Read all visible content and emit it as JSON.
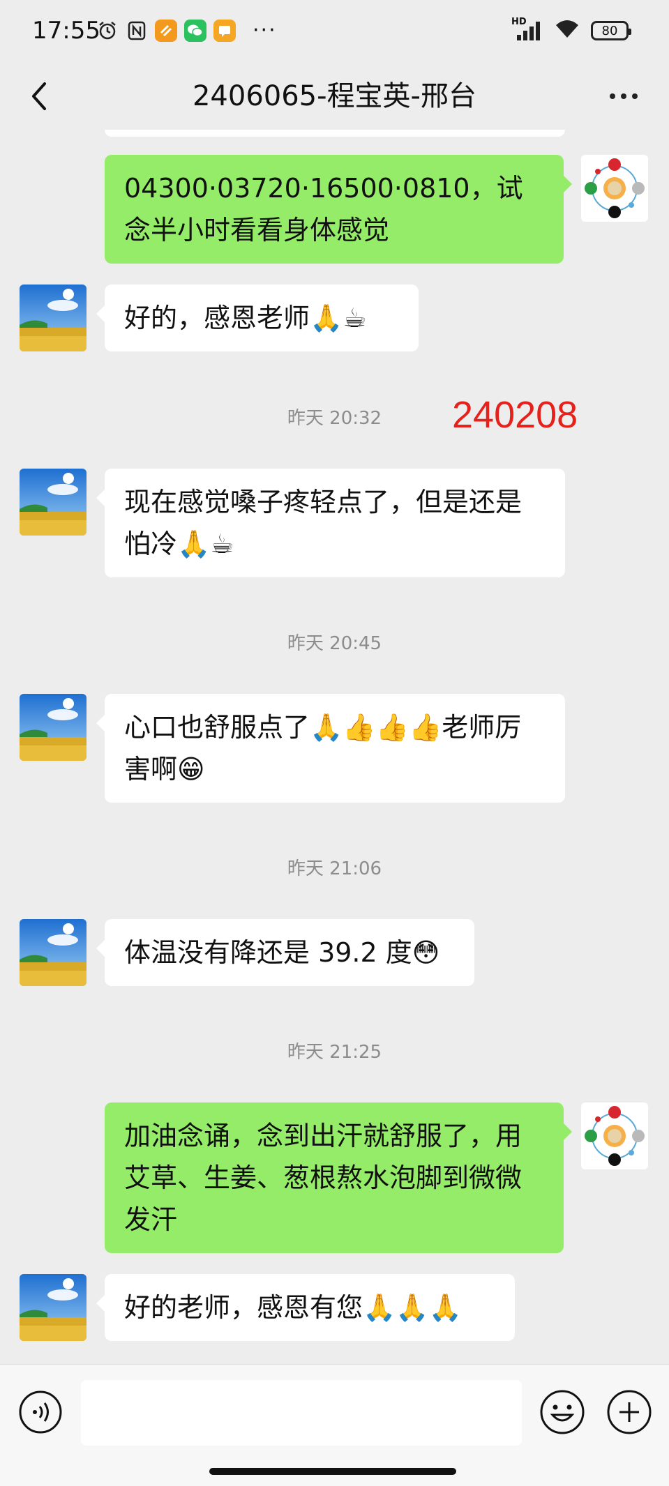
{
  "status_bar": {
    "time": "17:55",
    "network": "HD",
    "battery": "80",
    "more": "···"
  },
  "header": {
    "title": "2406065-程宝英-邢台"
  },
  "messages": [
    {
      "type": "out",
      "text": "04300·03720·16500·0810，试念半小时看看身体感觉"
    },
    {
      "type": "in",
      "text": "好的，感恩老师🙏☕"
    },
    {
      "type": "time",
      "text": "昨天 20:32"
    },
    {
      "type": "in",
      "text": "现在感觉嗓子疼轻点了，但是还是怕冷🙏☕"
    },
    {
      "type": "time",
      "text": "昨天 20:45"
    },
    {
      "type": "in",
      "text": "心口也舒服点了🙏👍👍👍老师厉害啊😁"
    },
    {
      "type": "time",
      "text": "昨天 21:06"
    },
    {
      "type": "in",
      "text": "体温没有降还是 39.2 度😳"
    },
    {
      "type": "time",
      "text": "昨天 21:25"
    },
    {
      "type": "out",
      "text": "加油念诵，念到出汗就舒服了，用艾草、生姜、葱根熬水泡脚到微微发汗"
    },
    {
      "type": "in",
      "text": "好的老师，感恩有您🙏🙏🙏"
    }
  ],
  "annotation": "240208",
  "colors": {
    "background": "#ededed",
    "outgoing_bubble": "#95ec69",
    "incoming_bubble": "#ffffff",
    "annotation_red": "#e6211b",
    "timestamp_grey": "#8c8c8c"
  },
  "icons": [
    "alarm-icon",
    "nfc-icon",
    "app-icon",
    "wechat-icon",
    "message-app-icon",
    "signal-icon",
    "wifi-icon",
    "battery-icon",
    "back-icon",
    "more-icon",
    "voice-icon",
    "emoji-icon",
    "plus-icon"
  ]
}
